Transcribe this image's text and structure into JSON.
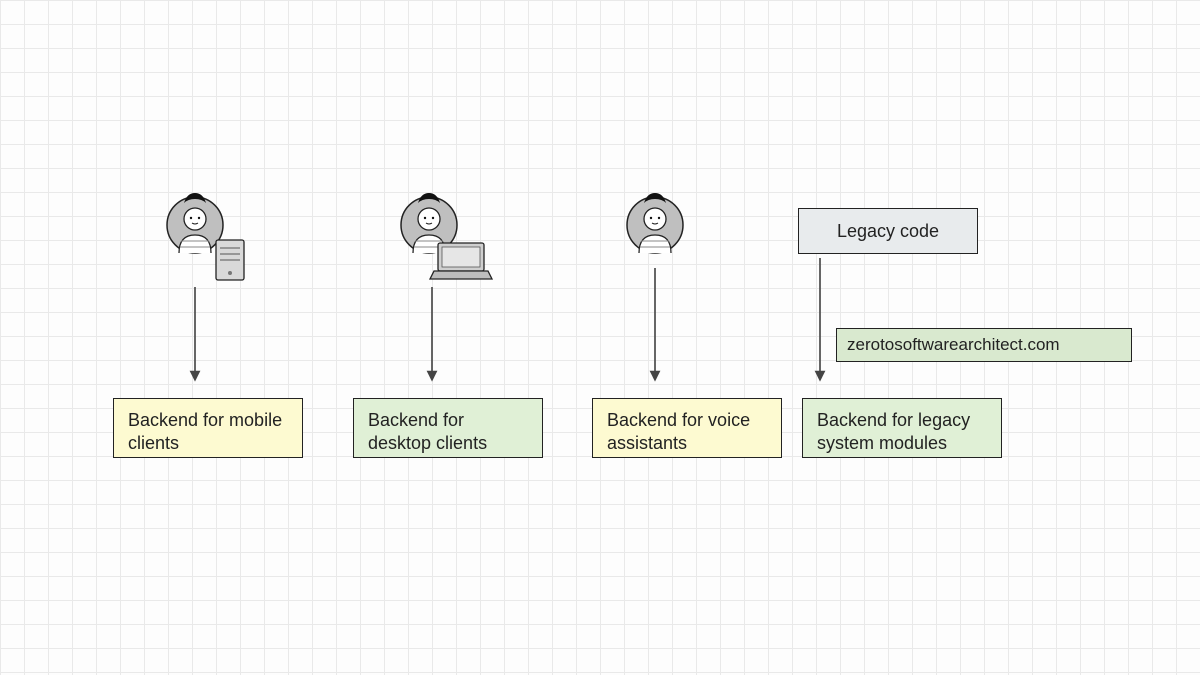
{
  "nodes": {
    "mobile": {
      "icon": "user-mobile",
      "label": "Backend for mobile clients",
      "color": "yellow"
    },
    "desktop": {
      "icon": "user-desktop",
      "label": "Backend for desktop clients",
      "color": "green"
    },
    "voice": {
      "icon": "user-voice",
      "label": "Backend for voice assistants",
      "color": "yellow"
    },
    "legacy": {
      "source_label": "Legacy code",
      "label": "Backend for legacy system modules",
      "color": "green"
    }
  },
  "attribution": "zerotosoftwarearchitect.com"
}
